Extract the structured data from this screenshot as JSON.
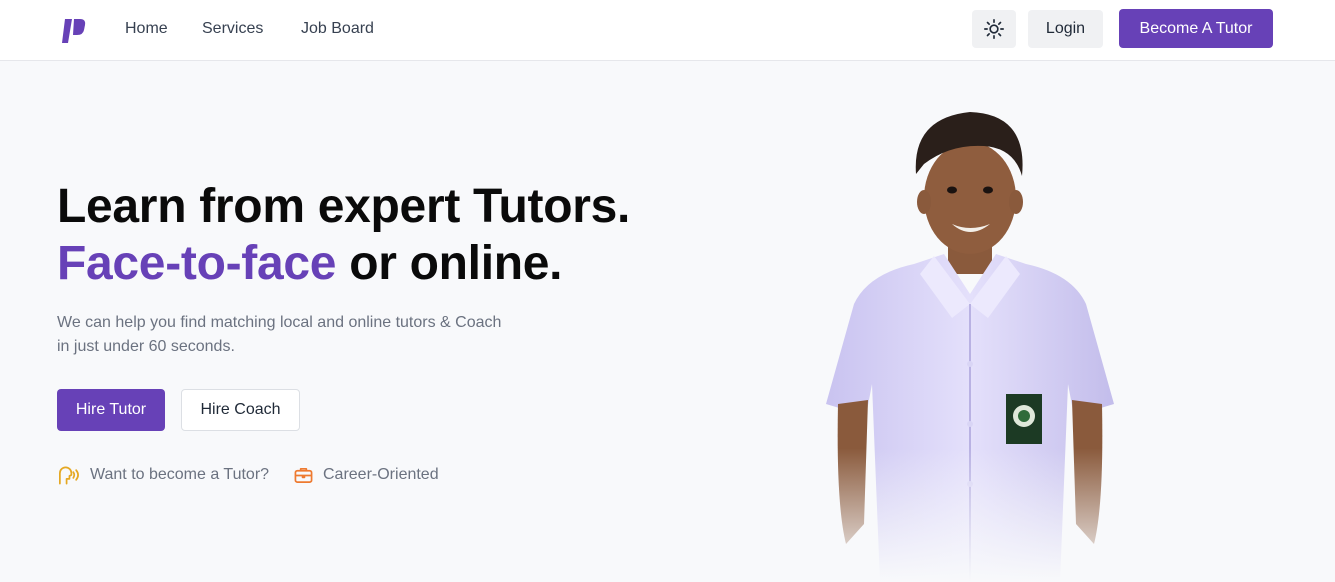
{
  "brand": {
    "logo_icon": "brand-logo-icon",
    "accent_color": "#6741b7"
  },
  "nav": {
    "links": [
      {
        "label": "Home"
      },
      {
        "label": "Services"
      },
      {
        "label": "Job Board"
      }
    ],
    "theme_icon": "sun-icon",
    "login_label": "Login",
    "become_tutor_label": "Become A Tutor"
  },
  "hero": {
    "title_line1": "Learn from expert Tutors.",
    "title_line2_accent": "Face-to-face",
    "title_line2_rest": " or online.",
    "subtitle": "We can help you find matching local and online tutors & Coach in just under 60 seconds.",
    "hire_tutor_label": "Hire Tutor",
    "hire_coach_label": "Hire Coach",
    "features": [
      {
        "icon": "speaking-person-icon",
        "label": "Want to become a Tutor?",
        "color": "#e5a823"
      },
      {
        "icon": "briefcase-icon",
        "label": "Career-Oriented",
        "color": "#ee7a30"
      }
    ],
    "image": "student-photo"
  }
}
